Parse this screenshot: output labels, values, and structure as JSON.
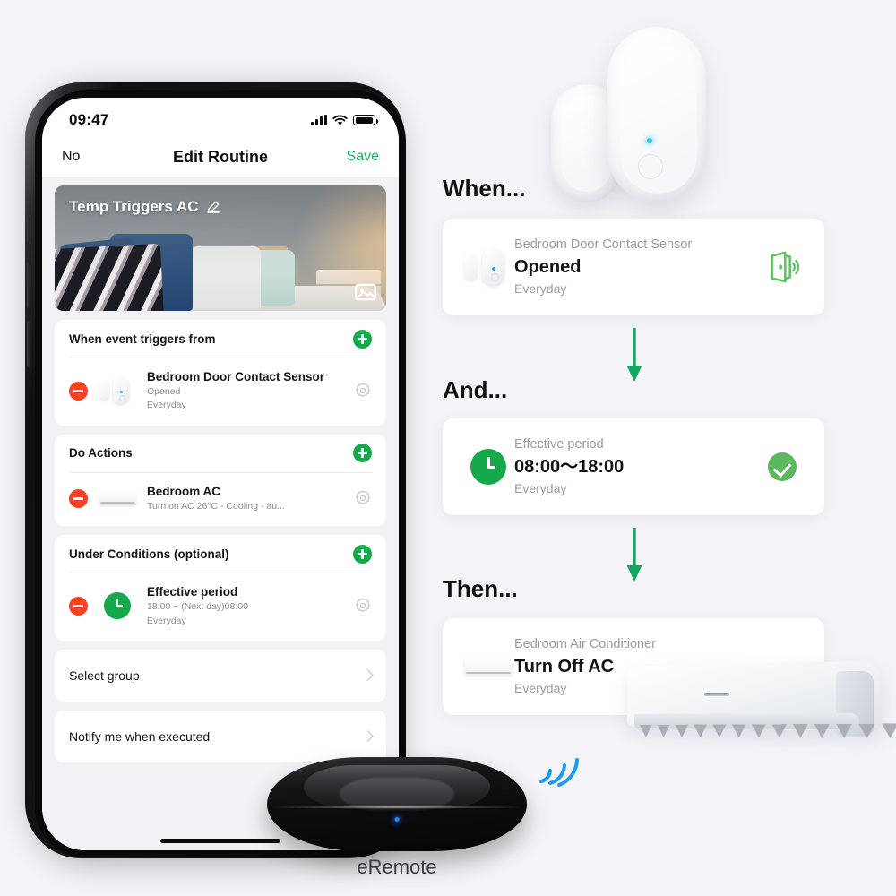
{
  "background_color": "#f4f4f8",
  "accent_green": "#16a94b",
  "accent_red": "#f4411f",
  "phone": {
    "status_bar": {
      "time": "09:47",
      "icons": [
        "signal-bars-icon",
        "wifi-icon",
        "battery-icon"
      ]
    },
    "nav": {
      "left_label": "No",
      "title": "Edit Routine",
      "right_label": "Save"
    },
    "hero": {
      "title": "Temp Triggers AC",
      "edit_icon": "pencil-icon",
      "image_badge_icon": "photo-icon"
    },
    "sections": [
      {
        "header": "When event triggers from",
        "add_icon": "plus-circle-icon",
        "items": [
          {
            "remove_icon": "minus-circle-icon",
            "device_icon": "contact-sensor-icon",
            "title": "Bedroom Door Contact Sensor",
            "sub1": "Opened",
            "sub2": "Everyday",
            "settings_icon": "gear-icon"
          }
        ]
      },
      {
        "header": "Do Actions",
        "add_icon": "plus-circle-icon",
        "items": [
          {
            "remove_icon": "minus-circle-icon",
            "device_icon": "air-conditioner-icon",
            "title": "Bedroom AC",
            "sub1": "Turn on AC 26°C - Cooling - au...",
            "sub2": "",
            "settings_icon": "gear-icon"
          }
        ]
      },
      {
        "header": "Under Conditions (optional)",
        "add_icon": "plus-circle-icon",
        "items": [
          {
            "remove_icon": "minus-circle-icon",
            "device_icon": "clock-icon",
            "title": "Effective period",
            "sub1": "18:00 ~ (Next day)08:00",
            "sub2": "Everyday",
            "settings_icon": "gear-icon"
          }
        ]
      }
    ],
    "simple_rows": [
      {
        "label": "Select group",
        "chevron_icon": "chevron-right-icon"
      },
      {
        "label": "Notify me when executed",
        "chevron_icon": "chevron-right-icon"
      }
    ]
  },
  "flow": {
    "steps": [
      {
        "label": "When...",
        "icon": "contact-sensor-icon",
        "device": "Bedroom Door Contact Sensor",
        "state": "Opened",
        "schedule": "Everyday",
        "status_icon": "open-door-icon"
      },
      {
        "label": "And...",
        "icon": "clock-icon",
        "device": "Effective period",
        "state": "08:00〜18:00",
        "schedule": "Everyday",
        "status_icon": "check-circle-icon"
      },
      {
        "label": "Then...",
        "icon": "air-conditioner-icon",
        "device": "Bedroom Air Conditioner",
        "state": "Turn Off AC",
        "schedule": "Everyday",
        "status_icon": ""
      }
    ],
    "arrow_icon": "arrow-down-icon",
    "arrow_color": "#14a85f"
  },
  "devices": {
    "contact_sensor_photo": "contact-sensor-photo",
    "ac_photo": "air-conditioner-photo",
    "eremote": {
      "label": "eRemote",
      "photo": "eremote-photo",
      "signal_icon": "wifi-signal-icon"
    }
  }
}
